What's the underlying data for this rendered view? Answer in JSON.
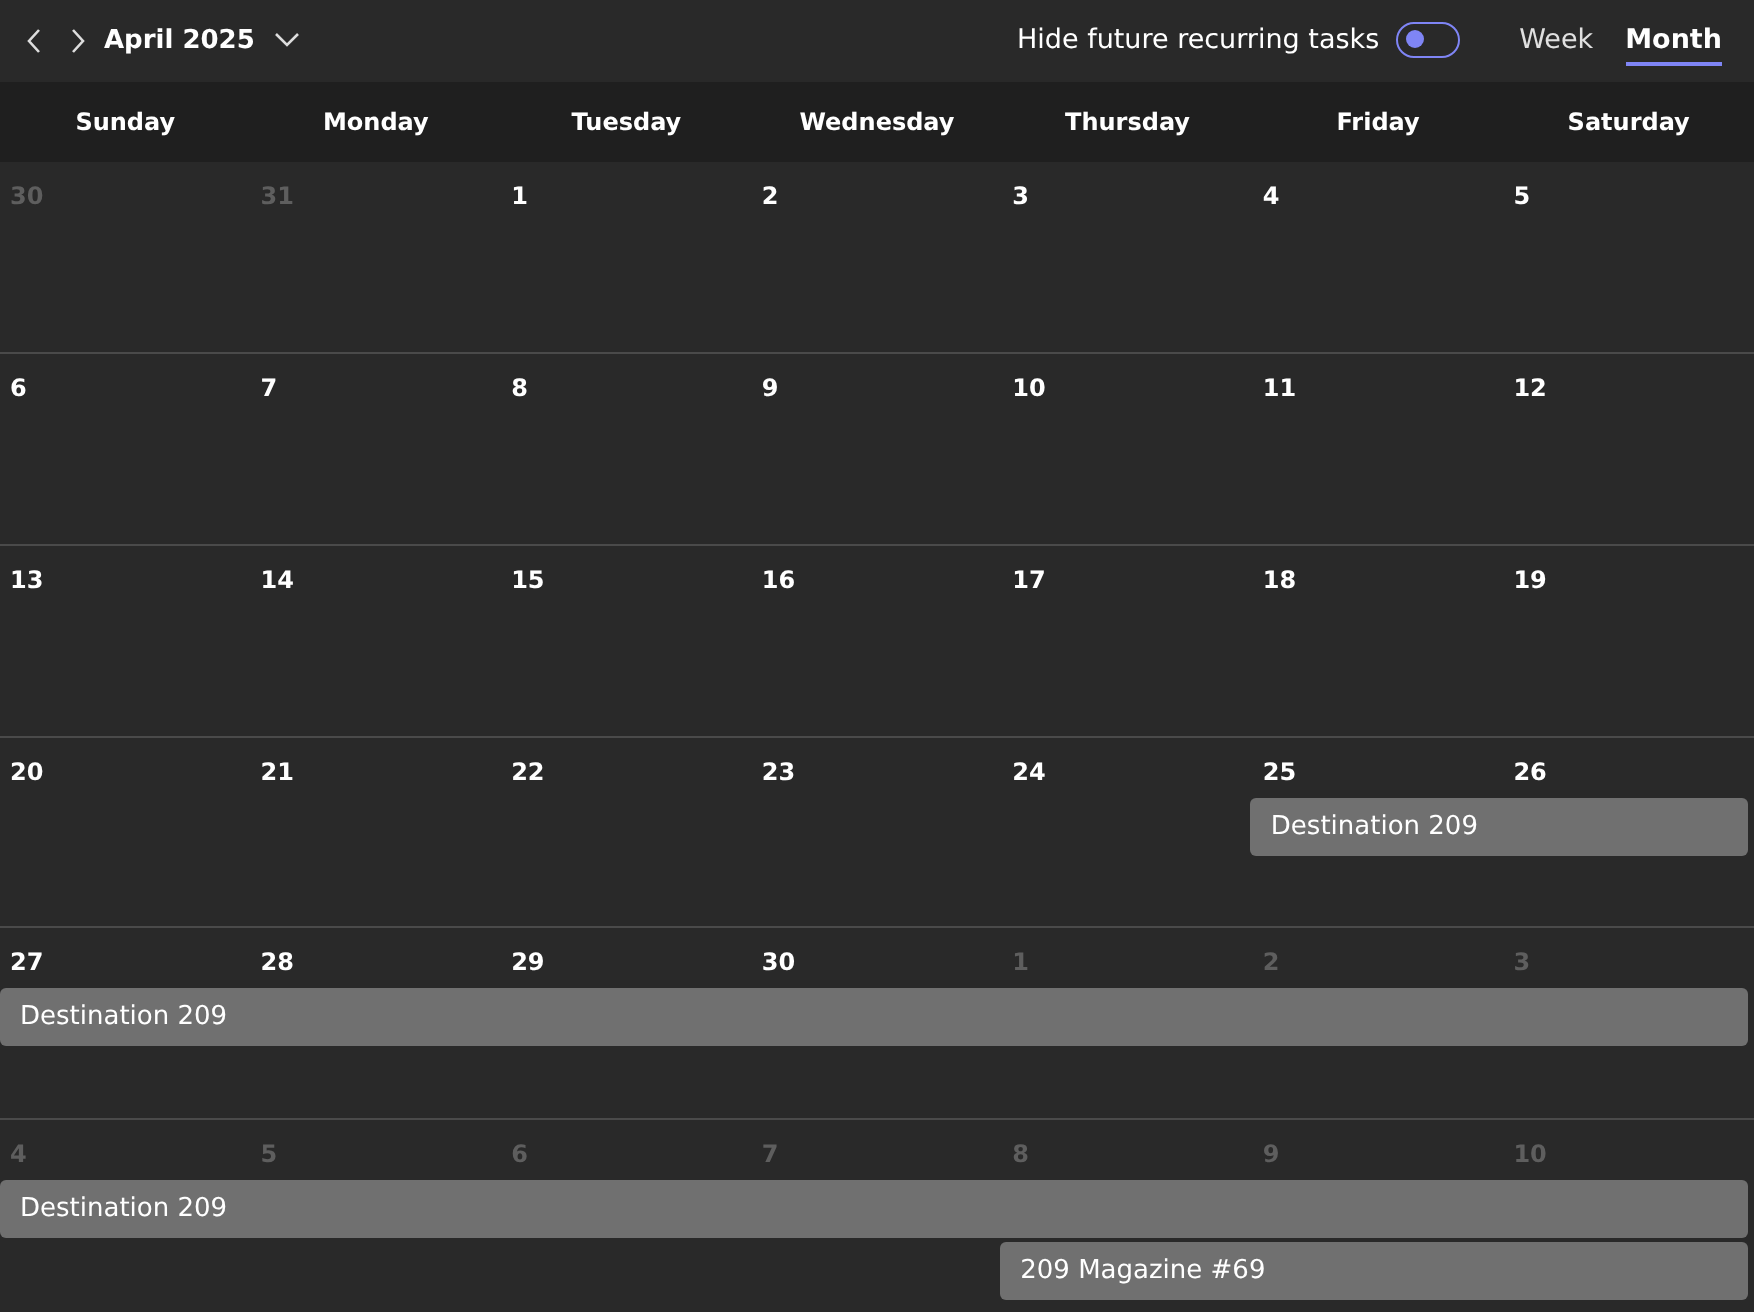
{
  "toolbar": {
    "month_label": "April 2025",
    "toggle": {
      "label": "Hide future recurring tasks",
      "on": false
    },
    "views": [
      {
        "label": "Week",
        "selected": false
      },
      {
        "label": "Month",
        "selected": true
      }
    ]
  },
  "weekdays": [
    "Sunday",
    "Monday",
    "Tuesday",
    "Wednesday",
    "Thursday",
    "Friday",
    "Saturday"
  ],
  "weeks": [
    {
      "days": [
        {
          "label": "30",
          "current_month": false
        },
        {
          "label": "31",
          "current_month": false
        },
        {
          "label": "1",
          "current_month": true
        },
        {
          "label": "2",
          "current_month": true
        },
        {
          "label": "3",
          "current_month": true
        },
        {
          "label": "4",
          "current_month": true
        },
        {
          "label": "5",
          "current_month": true
        }
      ]
    },
    {
      "days": [
        {
          "label": "6",
          "current_month": true
        },
        {
          "label": "7",
          "current_month": true
        },
        {
          "label": "8",
          "current_month": true
        },
        {
          "label": "9",
          "current_month": true
        },
        {
          "label": "10",
          "current_month": true
        },
        {
          "label": "11",
          "current_month": true
        },
        {
          "label": "12",
          "current_month": true
        }
      ]
    },
    {
      "days": [
        {
          "label": "13",
          "current_month": true
        },
        {
          "label": "14",
          "current_month": true
        },
        {
          "label": "15",
          "current_month": true
        },
        {
          "label": "16",
          "current_month": true
        },
        {
          "label": "17",
          "current_month": true
        },
        {
          "label": "18",
          "current_month": true
        },
        {
          "label": "19",
          "current_month": true
        }
      ]
    },
    {
      "days": [
        {
          "label": "20",
          "current_month": true
        },
        {
          "label": "21",
          "current_month": true
        },
        {
          "label": "22",
          "current_month": true
        },
        {
          "label": "23",
          "current_month": true
        },
        {
          "label": "24",
          "current_month": true
        },
        {
          "label": "25",
          "current_month": true
        },
        {
          "label": "26",
          "current_month": true
        }
      ],
      "lanes": [
        [
          {
            "kind": "empty"
          },
          {
            "kind": "empty"
          },
          {
            "kind": "empty"
          },
          {
            "kind": "empty"
          },
          {
            "kind": "empty"
          },
          {
            "kind": "start",
            "title": "Destination 209"
          },
          {
            "kind": "continue"
          }
        ]
      ]
    },
    {
      "days": [
        {
          "label": "27",
          "current_month": true
        },
        {
          "label": "28",
          "current_month": true
        },
        {
          "label": "29",
          "current_month": true
        },
        {
          "label": "30",
          "current_month": true
        },
        {
          "label": "1",
          "current_month": false
        },
        {
          "label": "2",
          "current_month": false
        },
        {
          "label": "3",
          "current_month": false
        }
      ],
      "lanes": [
        [
          {
            "kind": "start",
            "title": "Destination 209"
          },
          {
            "kind": "continue"
          },
          {
            "kind": "continue"
          },
          {
            "kind": "continue"
          },
          {
            "kind": "continue"
          },
          {
            "kind": "continue"
          },
          {
            "kind": "continue"
          }
        ]
      ]
    },
    {
      "days": [
        {
          "label": "4",
          "current_month": false
        },
        {
          "label": "5",
          "current_month": false
        },
        {
          "label": "6",
          "current_month": false
        },
        {
          "label": "7",
          "current_month": false
        },
        {
          "label": "8",
          "current_month": false
        },
        {
          "label": "9",
          "current_month": false
        },
        {
          "label": "10",
          "current_month": false
        }
      ],
      "lanes": [
        [
          {
            "kind": "start",
            "title": "Destination 209"
          },
          {
            "kind": "continue"
          },
          {
            "kind": "continue"
          },
          {
            "kind": "continue"
          },
          {
            "kind": "continue"
          },
          {
            "kind": "continue"
          },
          {
            "kind": "continue"
          }
        ],
        [
          {
            "kind": "empty"
          },
          {
            "kind": "empty"
          },
          {
            "kind": "empty"
          },
          {
            "kind": "empty"
          },
          {
            "kind": "start",
            "title": "209 Magazine #69"
          },
          {
            "kind": "continue"
          },
          {
            "kind": "continue"
          }
        ]
      ]
    }
  ]
}
